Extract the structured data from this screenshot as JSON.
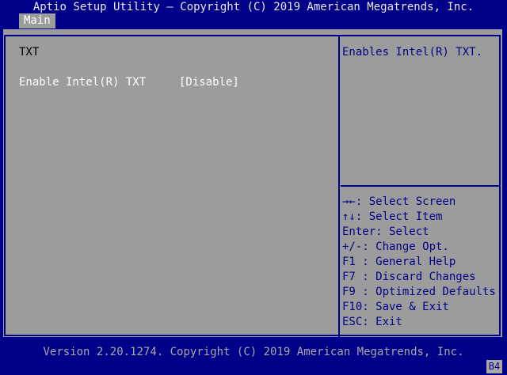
{
  "header": {
    "title": "Aptio Setup Utility – Copyright (C) 2019 American Megatrends, Inc.",
    "tab": "Main"
  },
  "main": {
    "section_title": "TXT",
    "setting": {
      "label": "Enable Intel(R) TXT",
      "value": "[Disable]"
    }
  },
  "help": {
    "text": "Enables Intel(R) TXT."
  },
  "keys": [
    "→←: Select Screen",
    "↑↓: Select Item",
    "Enter: Select",
    "+/-: Change Opt.",
    "F1 : General Help",
    "F7 : Discard Changes",
    "F9 : Optimized Defaults",
    "F10: Save & Exit",
    "ESC: Exit"
  ],
  "footer": {
    "version": "Version 2.20.1274. Copyright (C) 2019 American Megatrends, Inc.",
    "corner": "B4"
  }
}
